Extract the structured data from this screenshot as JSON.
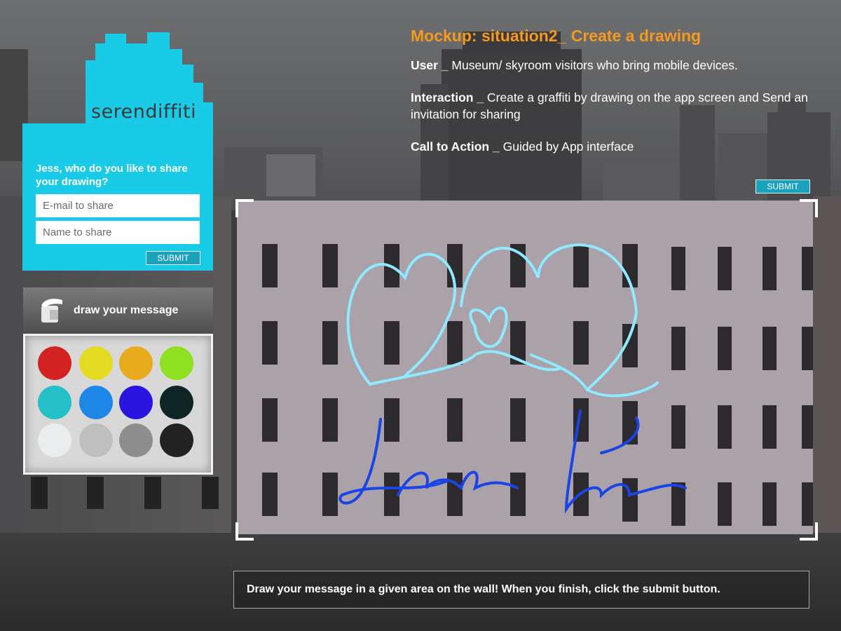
{
  "mockup": {
    "title": "Mockup: situation2_ Create a drawing",
    "user_label": "User _",
    "user_text": " Museum/ skyroom visitors who bring mobile devices.",
    "interaction_label": "Interaction _",
    "interaction_text": " Create a graffiti by drawing on the app screen and Send an invitation for sharing",
    "cta_label": "Call to Action _",
    "cta_text": " Guided by App interface",
    "submit_label": "SUBMIT"
  },
  "app": {
    "logo_text": "serendiffiti",
    "share_prompt": "Jess, who do you like to share your drawing?",
    "email_placeholder": "E-mail to share",
    "name_placeholder": "Name to share",
    "submit_label": "SUBMIT",
    "draw_label": "draw your message",
    "colors": [
      "#d22222",
      "#e4dc22",
      "#e8ab1e",
      "#8ee020",
      "#25c0c7",
      "#1e86e6",
      "#2a14e0",
      "#0f2424",
      "#e9eded",
      "#bfbfbf",
      "#8e8e8e",
      "#222222"
    ]
  },
  "wall": {
    "handwriting": "I love You",
    "drawing_colors": [
      "#8fe9ff",
      "#1a44e6"
    ]
  },
  "instruction": "Draw your message in a given area on the wall! When you finish, click the submit button."
}
